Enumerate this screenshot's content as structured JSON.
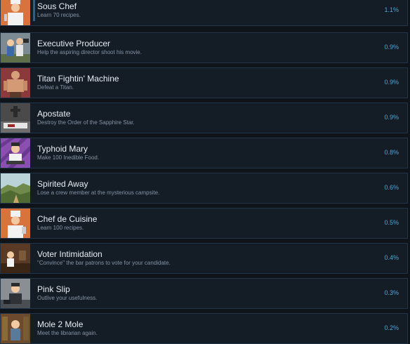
{
  "achievements": [
    {
      "title": "Sous Chef",
      "description": "Learn 70 recipes.",
      "percent": "1.1%",
      "icon": "chef-portrait-icon"
    },
    {
      "title": "Executive Producer",
      "description": "Help the aspiring director shoot his movie.",
      "percent": "0.9%",
      "icon": "film-crew-icon"
    },
    {
      "title": "Titan Fightin' Machine",
      "description": "Defeat a Titan.",
      "percent": "0.9%",
      "icon": "titan-icon"
    },
    {
      "title": "Apostate",
      "description": "Destroy the Order of the Sapphire Star.",
      "percent": "0.9%",
      "icon": "altar-icon"
    },
    {
      "title": "Typhoid Mary",
      "description": "Make 100 Inedible Food.",
      "percent": "0.8%",
      "icon": "cook-purple-icon"
    },
    {
      "title": "Spirited Away",
      "description": "Lose a crew member at the mysterious campsite.",
      "percent": "0.6%",
      "icon": "landscape-icon"
    },
    {
      "title": "Chef de Cuisine",
      "description": "Learn 100 recipes.",
      "percent": "0.5%",
      "icon": "chef-portrait-icon"
    },
    {
      "title": "Voter Intimidation",
      "description": "\"Convince\" the bar patrons to vote for your candidate.",
      "percent": "0.4%",
      "icon": "bar-patron-icon"
    },
    {
      "title": "Pink Slip",
      "description": "Outlive your usefulness.",
      "percent": "0.3%",
      "icon": "office-worker-icon"
    },
    {
      "title": "Mole 2 Mole",
      "description": "Meet the librarian again.",
      "percent": "0.2%",
      "icon": "librarian-icon"
    }
  ],
  "colors": {
    "background": "#0f141b",
    "row": "#141c26",
    "border": "#223448",
    "title": "#e6edf3",
    "description": "#8494a6",
    "percent": "#4fa6d8"
  }
}
